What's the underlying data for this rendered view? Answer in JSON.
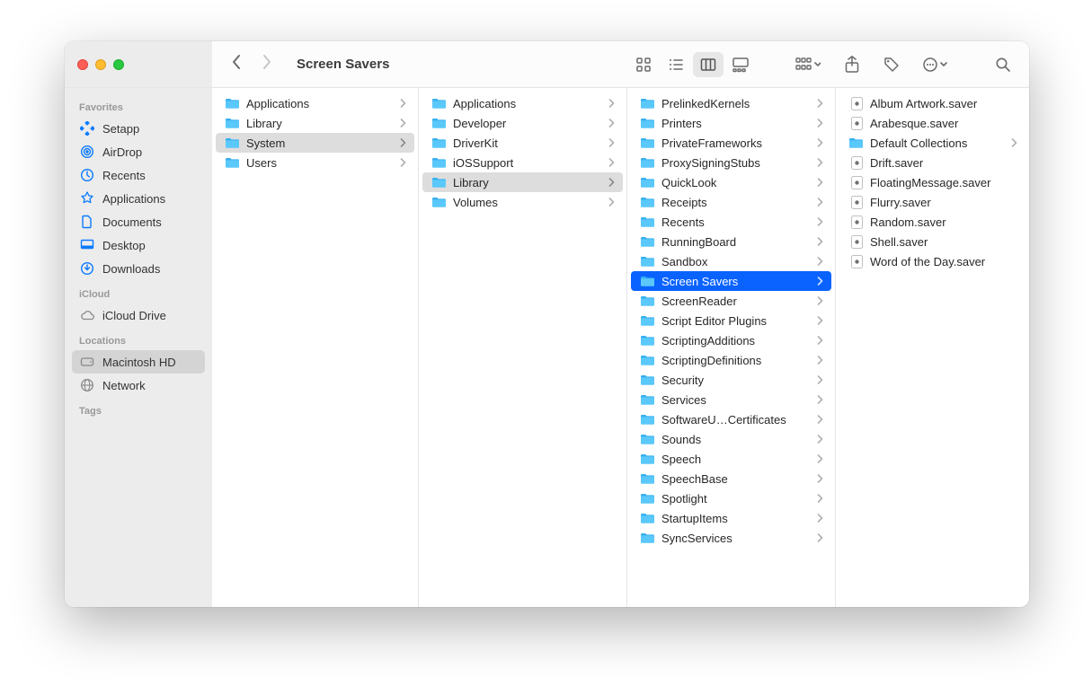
{
  "window": {
    "title": "Screen Savers"
  },
  "sidebar": {
    "sections": [
      {
        "label": "Favorites",
        "items": [
          {
            "label": "Setapp",
            "icon": "setapp-icon"
          },
          {
            "label": "AirDrop",
            "icon": "airdrop-icon"
          },
          {
            "label": "Recents",
            "icon": "clock-icon"
          },
          {
            "label": "Applications",
            "icon": "apps-icon"
          },
          {
            "label": "Documents",
            "icon": "doc-icon"
          },
          {
            "label": "Desktop",
            "icon": "desktop-icon"
          },
          {
            "label": "Downloads",
            "icon": "download-icon"
          }
        ]
      },
      {
        "label": "iCloud",
        "items": [
          {
            "label": "iCloud Drive",
            "icon": "cloud-icon"
          }
        ]
      },
      {
        "label": "Locations",
        "items": [
          {
            "label": "Macintosh HD",
            "icon": "disk-icon",
            "selected": true
          },
          {
            "label": "Network",
            "icon": "globe-icon"
          }
        ]
      },
      {
        "label": "Tags",
        "items": []
      }
    ]
  },
  "columns": [
    {
      "items": [
        {
          "label": "Applications",
          "type": "folder"
        },
        {
          "label": "Library",
          "type": "folder"
        },
        {
          "label": "System",
          "type": "folder",
          "path": true
        },
        {
          "label": "Users",
          "type": "folder"
        }
      ]
    },
    {
      "items": [
        {
          "label": "Applications",
          "type": "folder"
        },
        {
          "label": "Developer",
          "type": "folder"
        },
        {
          "label": "DriverKit",
          "type": "folder"
        },
        {
          "label": "iOSSupport",
          "type": "folder"
        },
        {
          "label": "Library",
          "type": "folder",
          "path": true
        },
        {
          "label": "Volumes",
          "type": "folder"
        }
      ]
    },
    {
      "items": [
        {
          "label": "PrelinkedKernels",
          "type": "folder"
        },
        {
          "label": "Printers",
          "type": "folder"
        },
        {
          "label": "PrivateFrameworks",
          "type": "folder"
        },
        {
          "label": "ProxySigningStubs",
          "type": "folder"
        },
        {
          "label": "QuickLook",
          "type": "folder"
        },
        {
          "label": "Receipts",
          "type": "folder"
        },
        {
          "label": "Recents",
          "type": "folder"
        },
        {
          "label": "RunningBoard",
          "type": "folder"
        },
        {
          "label": "Sandbox",
          "type": "folder"
        },
        {
          "label": "Screen Savers",
          "type": "folder",
          "selected": true
        },
        {
          "label": "ScreenReader",
          "type": "folder"
        },
        {
          "label": "Script Editor Plugins",
          "type": "folder"
        },
        {
          "label": "ScriptingAdditions",
          "type": "folder"
        },
        {
          "label": "ScriptingDefinitions",
          "type": "folder"
        },
        {
          "label": "Security",
          "type": "folder"
        },
        {
          "label": "Services",
          "type": "folder"
        },
        {
          "label": "SoftwareU…Certificates",
          "type": "folder"
        },
        {
          "label": "Sounds",
          "type": "folder"
        },
        {
          "label": "Speech",
          "type": "folder"
        },
        {
          "label": "SpeechBase",
          "type": "folder"
        },
        {
          "label": "Spotlight",
          "type": "folder"
        },
        {
          "label": "StartupItems",
          "type": "folder"
        },
        {
          "label": "SyncServices",
          "type": "folder"
        }
      ]
    },
    {
      "items": [
        {
          "label": "Album Artwork.saver",
          "type": "file"
        },
        {
          "label": "Arabesque.saver",
          "type": "file"
        },
        {
          "label": "Default Collections",
          "type": "folder"
        },
        {
          "label": "Drift.saver",
          "type": "file"
        },
        {
          "label": "FloatingMessage.saver",
          "type": "file"
        },
        {
          "label": "Flurry.saver",
          "type": "file"
        },
        {
          "label": "Random.saver",
          "type": "file"
        },
        {
          "label": "Shell.saver",
          "type": "file"
        },
        {
          "label": "Word of the Day.saver",
          "type": "file"
        }
      ]
    }
  ]
}
